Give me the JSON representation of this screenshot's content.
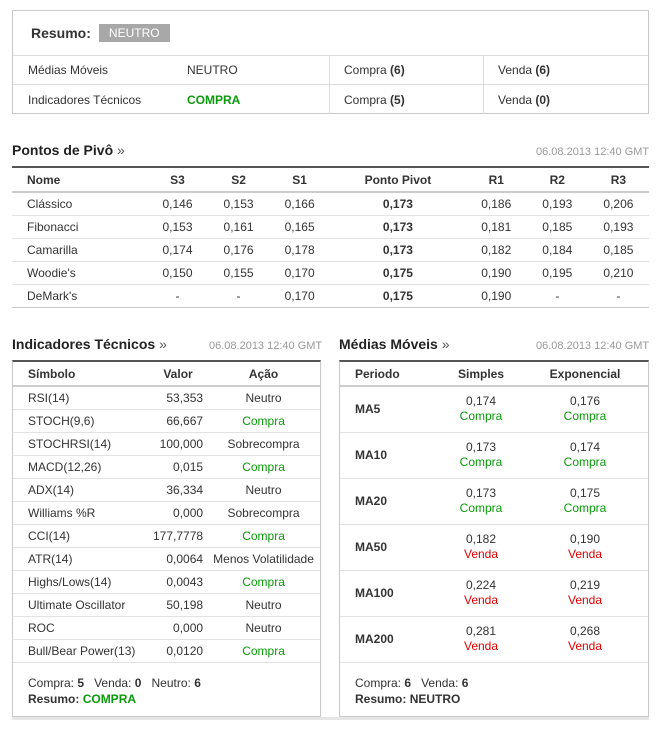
{
  "summary": {
    "label": "Resumo:",
    "badge": "NEUTRO",
    "rows": [
      {
        "name": "Médias Móveis",
        "signal": "NEUTRO",
        "buy_label": "Compra",
        "buy": "(6)",
        "sell_label": "Venda",
        "sell": "(6)"
      },
      {
        "name": "Indicadores Técnicos",
        "signal": "COMPRA",
        "buy_label": "Compra",
        "buy": "(5)",
        "sell_label": "Venda",
        "sell": "(0)"
      }
    ]
  },
  "pivot": {
    "title": "Pontos de Pivô",
    "arrow": "»",
    "date": "06.08.2013 12:40 GMT",
    "headers": [
      "Nome",
      "S3",
      "S2",
      "S1",
      "Ponto Pivot",
      "R1",
      "R2",
      "R3"
    ],
    "rows": [
      [
        "Clássico",
        "0,146",
        "0,153",
        "0,166",
        "0,173",
        "0,186",
        "0,193",
        "0,206"
      ],
      [
        "Fibonacci",
        "0,153",
        "0,161",
        "0,165",
        "0,173",
        "0,181",
        "0,185",
        "0,193"
      ],
      [
        "Camarilla",
        "0,174",
        "0,176",
        "0,178",
        "0,173",
        "0,182",
        "0,184",
        "0,185"
      ],
      [
        "Woodie's",
        "0,150",
        "0,155",
        "0,170",
        "0,175",
        "0,190",
        "0,195",
        "0,210"
      ],
      [
        "DeMark's",
        "-",
        "-",
        "0,170",
        "0,175",
        "0,190",
        "-",
        "-"
      ]
    ]
  },
  "tech": {
    "title": "Indicadores Técnicos",
    "arrow": "»",
    "date": "06.08.2013 12:40 GMT",
    "headers": [
      "Símbolo",
      "Valor",
      "Ação"
    ],
    "rows": [
      {
        "symbol": "RSI(14)",
        "value": "53,353",
        "action": "Neutro",
        "color": "none"
      },
      {
        "symbol": "STOCH(9,6)",
        "value": "66,667",
        "action": "Compra",
        "color": "green"
      },
      {
        "symbol": "STOCHRSI(14)",
        "value": "100,000",
        "action": "Sobrecompra",
        "color": "none"
      },
      {
        "symbol": "MACD(12,26)",
        "value": "0,015",
        "action": "Compra",
        "color": "green"
      },
      {
        "symbol": "ADX(14)",
        "value": "36,334",
        "action": "Neutro",
        "color": "none"
      },
      {
        "symbol": "Williams %R",
        "value": "0,000",
        "action": "Sobrecompra",
        "color": "none"
      },
      {
        "symbol": "CCI(14)",
        "value": "177,7778",
        "action": "Compra",
        "color": "green"
      },
      {
        "symbol": "ATR(14)",
        "value": "0,0064",
        "action": "Menos Volatilidade",
        "color": "none"
      },
      {
        "symbol": "Highs/Lows(14)",
        "value": "0,0043",
        "action": "Compra",
        "color": "green"
      },
      {
        "symbol": "Ultimate Oscillator",
        "value": "50,198",
        "action": "Neutro",
        "color": "none"
      },
      {
        "symbol": "ROC",
        "value": "0,000",
        "action": "Neutro",
        "color": "none"
      },
      {
        "symbol": "Bull/Bear Power(13)",
        "value": "0,0120",
        "action": "Compra",
        "color": "green"
      }
    ],
    "footer": {
      "buy_label": "Compra:",
      "buy": "5",
      "sell_label": "Venda:",
      "sell": "0",
      "neutral_label": "Neutro:",
      "neutral": "6",
      "summary_label": "Resumo:",
      "summary": "COMPRA"
    }
  },
  "ma": {
    "title": "Médias Móveis",
    "arrow": "»",
    "date": "06.08.2013 12:40 GMT",
    "headers": [
      "Periodo",
      "Simples",
      "Exponencial"
    ],
    "rows": [
      {
        "period": "MA5",
        "simple": "0,174",
        "simple_action": "Compra",
        "simple_color": "green",
        "exp": "0,176",
        "exp_action": "Compra",
        "exp_color": "green"
      },
      {
        "period": "MA10",
        "simple": "0,173",
        "simple_action": "Compra",
        "simple_color": "green",
        "exp": "0,174",
        "exp_action": "Compra",
        "exp_color": "green"
      },
      {
        "period": "MA20",
        "simple": "0,173",
        "simple_action": "Compra",
        "simple_color": "green",
        "exp": "0,175",
        "exp_action": "Compra",
        "exp_color": "green"
      },
      {
        "period": "MA50",
        "simple": "0,182",
        "simple_action": "Venda",
        "simple_color": "red",
        "exp": "0,190",
        "exp_action": "Venda",
        "exp_color": "red"
      },
      {
        "period": "MA100",
        "simple": "0,224",
        "simple_action": "Venda",
        "simple_color": "red",
        "exp": "0,219",
        "exp_action": "Venda",
        "exp_color": "red"
      },
      {
        "period": "MA200",
        "simple": "0,281",
        "simple_action": "Venda",
        "simple_color": "red",
        "exp": "0,268",
        "exp_action": "Venda",
        "exp_color": "red"
      }
    ],
    "footer": {
      "buy_label": "Compra:",
      "buy": "6",
      "sell_label": "Venda:",
      "sell": "6",
      "summary_label": "Resumo:",
      "summary": "NEUTRO"
    }
  },
  "colors": {
    "buy": "#0a9a0a",
    "sell": "#e00000",
    "badge_bg": "#a8a8a8"
  }
}
